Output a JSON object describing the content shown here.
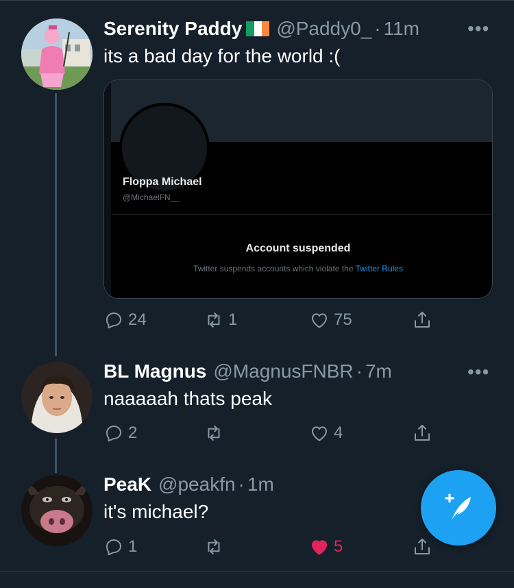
{
  "tweets": [
    {
      "name": "Serenity Paddy",
      "handle": "@Paddy0_",
      "separator": "·",
      "time": "11m",
      "text": "its a bad day for the world :(",
      "reply_count": "24",
      "retweet_count": "1",
      "like_count": "75",
      "liked": false,
      "flag_colors": [
        "#169b62",
        "#ffffff",
        "#ff883e"
      ]
    },
    {
      "name": "BL Magnus",
      "handle": "@MagnusFNBR",
      "separator": "·",
      "time": "7m",
      "text": "naaaaah thats peak",
      "reply_count": "2",
      "retweet_count": "",
      "like_count": "4",
      "liked": false
    },
    {
      "name": "PeaK",
      "handle": "@peakfn",
      "separator": "·",
      "time": "1m",
      "text": "it's michael?",
      "reply_count": "1",
      "retweet_count": "",
      "like_count": "5",
      "liked": true
    }
  ],
  "embedded_card": {
    "profile_name": "Floppa Michael",
    "profile_handle": "@MichaelFN__",
    "status_title": "Account suspended",
    "status_text": "Twitter suspends accounts which violate the ",
    "status_link": "Twitter Rules"
  },
  "more_label": "•••",
  "colors": {
    "background": "#15202b",
    "accent": "#1da1f2",
    "like_active": "#e0245e",
    "secondary_text": "#8899a6"
  },
  "icons": [
    "reply-icon",
    "retweet-icon",
    "like-icon",
    "share-icon",
    "compose-tweet-icon"
  ]
}
